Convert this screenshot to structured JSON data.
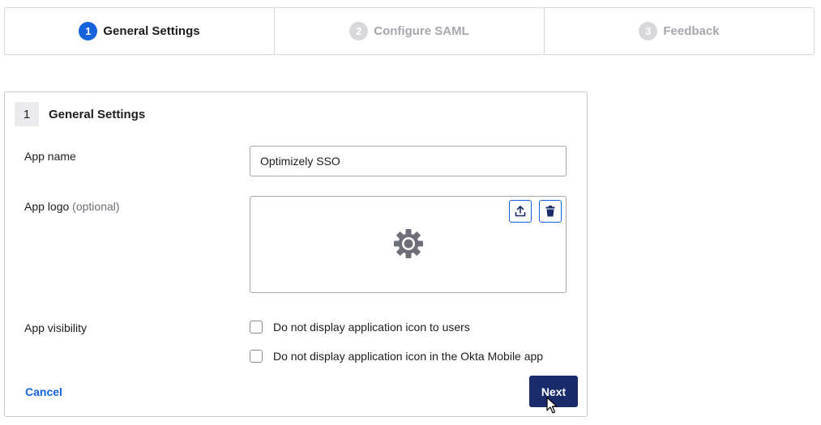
{
  "stepper": {
    "steps": [
      {
        "number": "1",
        "label": "General Settings",
        "state": "active"
      },
      {
        "number": "2",
        "label": "Configure SAML",
        "state": "inactive"
      },
      {
        "number": "3",
        "label": "Feedback",
        "state": "inactive"
      }
    ]
  },
  "card": {
    "number": "1",
    "title": "General Settings",
    "app_name": {
      "label": "App name",
      "value": "Optimizely SSO"
    },
    "app_logo": {
      "label": "App logo",
      "optional": "(optional)",
      "upload_icon": "upload-icon",
      "delete_icon": "trash-icon",
      "placeholder_icon": "gear-icon"
    },
    "app_visibility": {
      "label": "App visibility",
      "options": [
        {
          "label": "Do not display application icon to users",
          "checked": false
        },
        {
          "label": "Do not display application icon in the Okta Mobile app",
          "checked": false
        }
      ]
    },
    "cancel_label": "Cancel",
    "next_label": "Next"
  },
  "colors": {
    "accent": "#1662dd",
    "primary_button": "#1a2b6b",
    "inactive": "#a7a7ae"
  }
}
